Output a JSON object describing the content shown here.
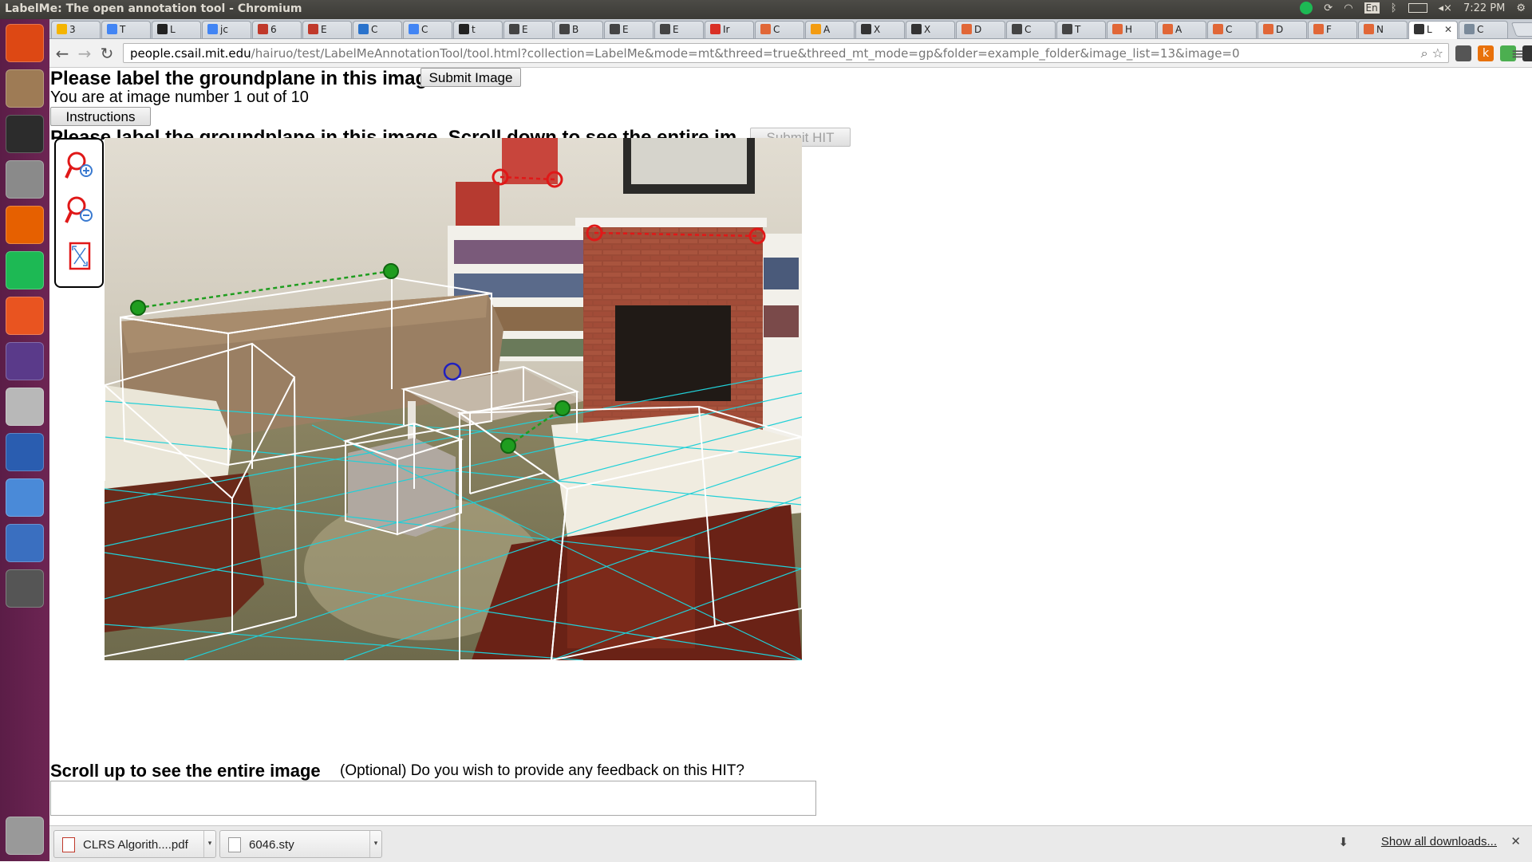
{
  "window": {
    "title": "LabelMe: The open annotation tool - Chromium",
    "clock": "7:22 PM",
    "keyboard": "En"
  },
  "tabs": [
    {
      "label": "3",
      "icon": "drive-icon",
      "color": "#f4b400"
    },
    {
      "label": "T",
      "icon": "docs-icon",
      "color": "#4285f4"
    },
    {
      "label": "L",
      "icon": "github-icon",
      "color": "#222222"
    },
    {
      "label": "jc",
      "icon": "docs-icon",
      "color": "#4285f4"
    },
    {
      "label": "6",
      "icon": "flag-icon",
      "color": "#c0392b"
    },
    {
      "label": "E",
      "icon": "flag-icon",
      "color": "#c0392b"
    },
    {
      "label": "C",
      "icon": "coursera-icon",
      "color": "#2a73cc"
    },
    {
      "label": "C",
      "icon": "docs-icon",
      "color": "#4285f4"
    },
    {
      "label": "t",
      "icon": "github-icon",
      "color": "#222222"
    },
    {
      "label": "E",
      "icon": "wiki-icon",
      "color": "#444444"
    },
    {
      "label": "B",
      "icon": "wiki-icon",
      "color": "#444444"
    },
    {
      "label": "E",
      "icon": "wiki-icon",
      "color": "#444444"
    },
    {
      "label": "E",
      "icon": "wiki-icon",
      "color": "#444444"
    },
    {
      "label": "Ir",
      "icon": "gmail-icon",
      "color": "#d93025"
    },
    {
      "label": "C",
      "icon": "matlab-icon",
      "color": "#e16737"
    },
    {
      "label": "A",
      "icon": "circle-icon",
      "color": "#f39c12"
    },
    {
      "label": "X",
      "icon": "w3-icon",
      "color": "#333333"
    },
    {
      "label": "X",
      "icon": "w3-icon",
      "color": "#333333"
    },
    {
      "label": "D",
      "icon": "matlab-icon",
      "color": "#e16737"
    },
    {
      "label": "C",
      "icon": "wiki-w-icon",
      "color": "#444444"
    },
    {
      "label": "T",
      "icon": "wiki-w-icon",
      "color": "#444444"
    },
    {
      "label": "H",
      "icon": "matlab-icon",
      "color": "#e16737"
    },
    {
      "label": "A",
      "icon": "matlab-icon",
      "color": "#e16737"
    },
    {
      "label": "C",
      "icon": "matlab-icon",
      "color": "#e16737"
    },
    {
      "label": "D",
      "icon": "matlab-icon",
      "color": "#e16737"
    },
    {
      "label": "F",
      "icon": "matlab-icon",
      "color": "#e16737"
    },
    {
      "label": "N",
      "icon": "matlab-icon",
      "color": "#e16737"
    },
    {
      "label": "L",
      "icon": "labelme-icon",
      "color": "#333333",
      "active": true
    },
    {
      "label": "C",
      "icon": "page-icon",
      "color": "#7a8a9a"
    }
  ],
  "address": {
    "host": "people.csail.mit.edu",
    "path": "/hairuo/test/LabelMeAnnotationTool/tool.html?collection=LabelMe&mode=mt&threed=true&threed_mt_mode=gp&folder=example_folder&image_list=13&image=0"
  },
  "extensions": [
    {
      "icon": "puzzle-icon",
      "color": "#555555"
    },
    {
      "icon": "k-icon",
      "color": "#e8710a",
      "label": "k"
    },
    {
      "icon": "eyedropper-icon",
      "color": "#4caf50"
    },
    {
      "icon": "pocket-icon",
      "color": "#333333"
    }
  ],
  "page": {
    "heading": "Please label the groundplane in this image.",
    "submit_image": "Submit Image",
    "image_counter": "You are at image number 1 out of 10",
    "instructions": "Instructions",
    "heading2": "Please label the groundplane in this image. Scroll down to see the entire image.",
    "submit_hit": "Submit HIT",
    "scroll_hint": "Scroll up to see the entire image",
    "feedback_prompt": "(Optional) Do you wish to provide any feedback on this HIT?",
    "feedback_value": ""
  },
  "tools": [
    {
      "name": "zoom-in-icon"
    },
    {
      "name": "zoom-out-icon"
    },
    {
      "name": "fit-to-screen-icon"
    }
  ],
  "colors": {
    "ground_grid": "#20d0d8",
    "box_edges": "#ffffff",
    "green_handle": "#1f9d1f",
    "red_handle": "#e01818",
    "blue_handle": "#2020c0"
  },
  "downloads": [
    {
      "name": "CLRS Algorith....pdf",
      "icon": "pdf-icon"
    },
    {
      "name": "6046.sty",
      "icon": "file-icon"
    }
  ],
  "shelf": {
    "show_all": "Show all downloads..."
  },
  "launcher": [
    {
      "icon": "ubuntu-icon",
      "color": "#dd4814"
    },
    {
      "icon": "files-icon",
      "color": "#9e7b55"
    },
    {
      "icon": "terminal-icon",
      "color": "#2c2c2c"
    },
    {
      "icon": "settings-icon",
      "color": "#8a8a8a"
    },
    {
      "icon": "firefox-icon",
      "color": "#e66000"
    },
    {
      "icon": "spotify-icon",
      "color": "#1db954"
    },
    {
      "icon": "software-center-icon",
      "color": "#e95420"
    },
    {
      "icon": "circle-app-icon",
      "color": "#5a3a8a"
    },
    {
      "icon": "drive-icon",
      "color": "#b8b8b8"
    },
    {
      "icon": "pen-icon",
      "color": "#2a5db0"
    },
    {
      "icon": "chromium-icon",
      "color": "#4a8ad8"
    },
    {
      "icon": "shotwell-icon",
      "color": "#3a6fc0"
    },
    {
      "icon": "update-icon",
      "color": "#555555"
    },
    {
      "icon": "trash-icon",
      "color": "#999999"
    }
  ]
}
